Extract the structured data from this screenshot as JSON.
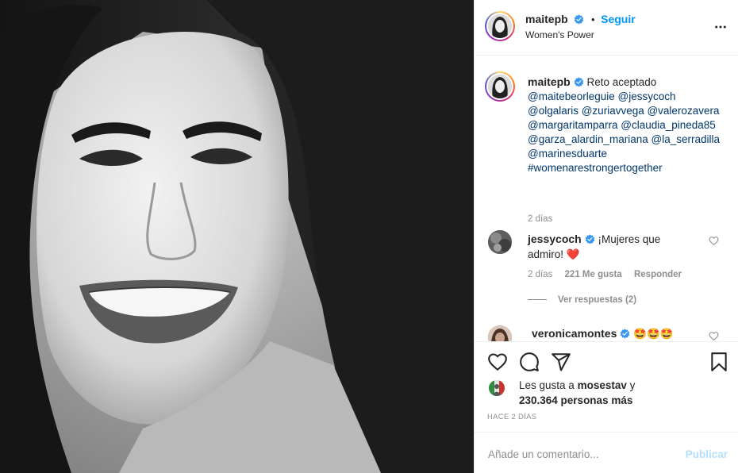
{
  "post": {
    "image_icon": "portrait-photo",
    "author": {
      "username": "maitepb",
      "verified_icon": "verified-badge-icon",
      "dot": "•",
      "follow_label": "Seguir",
      "subtitle": "Women's Power"
    },
    "more_icon": "more-options-icon"
  },
  "caption": {
    "username": "maitepb",
    "text": "Reto aceptado",
    "tags": "@maitebeorleguie @jessycoch @olgalaris @zuriavvega @valerozavera @margaritamparra @claudia_pineda85 @garza_alardin_mariana @la_serradilla @marinesduarte #womenarestrongertogether",
    "time": "2 días"
  },
  "comments": [
    {
      "username": "jessycoch",
      "text": "¡Mujeres que admiro!",
      "emoji": "❤️",
      "time": "2 días",
      "likes": "221 Me gusta",
      "reply_label": "Responder",
      "view_replies": "Ver respuestas (2)"
    },
    {
      "username": "veronicamontes",
      "text": "🤩🤩🤩"
    }
  ],
  "actions": {
    "like_icon": "heart-icon",
    "comment_icon": "comment-icon",
    "share_icon": "paper-plane-icon",
    "save_icon": "bookmark-icon"
  },
  "likes": {
    "prefix": "Les gusta a ",
    "user": "mosestav",
    "suffix": " y",
    "others": "230.364 personas más"
  },
  "time_ago": "HACE 2 DÍAS",
  "add_comment": {
    "placeholder": "Añade un comentario...",
    "publish_label": "Publicar"
  },
  "colors": {
    "link": "#0095f6",
    "tag": "#00376b",
    "muted": "#8e8e8e",
    "verified": "#3897f0",
    "heart": "#ed4956",
    "publish_disabled": "#b2dffc"
  }
}
